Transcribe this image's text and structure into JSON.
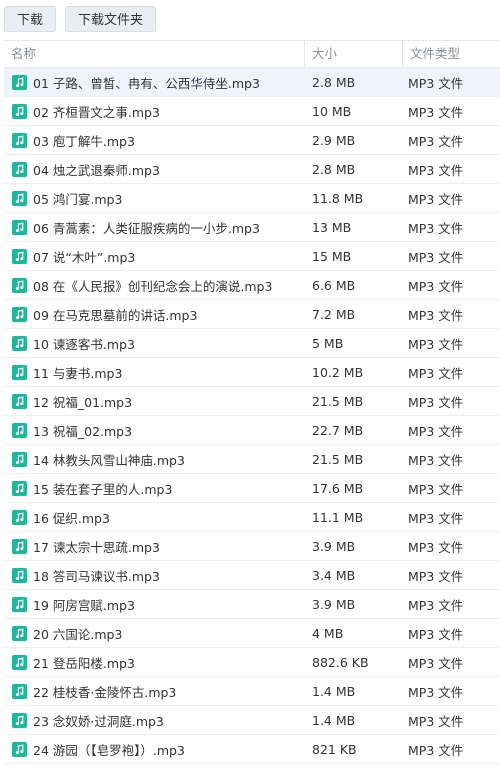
{
  "toolbar": {
    "download_label": "下载",
    "download_folder_label": "下载文件夹"
  },
  "table": {
    "headers": {
      "name": "名称",
      "size": "大小",
      "type": "文件类型"
    },
    "selected_index": 0,
    "rows": [
      {
        "name": "01 子路、曾皙、冉有、公西华侍坐.mp3",
        "size": "2.8 MB",
        "type": "MP3 文件"
      },
      {
        "name": "02 齐桓晋文之事.mp3",
        "size": "10 MB",
        "type": "MP3 文件"
      },
      {
        "name": "03 庖丁解牛.mp3",
        "size": "2.9 MB",
        "type": "MP3 文件"
      },
      {
        "name": "04 烛之武退秦师.mp3",
        "size": "2.8 MB",
        "type": "MP3 文件"
      },
      {
        "name": "05 鸿门宴.mp3",
        "size": "11.8 MB",
        "type": "MP3 文件"
      },
      {
        "name": "06 青蒿素：人类征服疾病的一小步.mp3",
        "size": "13 MB",
        "type": "MP3 文件"
      },
      {
        "name": "07 说“木叶”.mp3",
        "size": "15 MB",
        "type": "MP3 文件"
      },
      {
        "name": "08 在《人民报》创刊纪念会上的演说.mp3",
        "size": "6.6 MB",
        "type": "MP3 文件"
      },
      {
        "name": "09 在马克思墓前的讲话.mp3",
        "size": "7.2 MB",
        "type": "MP3 文件"
      },
      {
        "name": "10 谏逐客书.mp3",
        "size": "5 MB",
        "type": "MP3 文件"
      },
      {
        "name": "11 与妻书.mp3",
        "size": "10.2 MB",
        "type": "MP3 文件"
      },
      {
        "name": "12 祝福_01.mp3",
        "size": "21.5 MB",
        "type": "MP3 文件"
      },
      {
        "name": "13 祝福_02.mp3",
        "size": "22.7 MB",
        "type": "MP3 文件"
      },
      {
        "name": "14 林教头风雪山神庙.mp3",
        "size": "21.5 MB",
        "type": "MP3 文件"
      },
      {
        "name": "15 装在套子里的人.mp3",
        "size": "17.6 MB",
        "type": "MP3 文件"
      },
      {
        "name": "16 促织.mp3",
        "size": "11.1 MB",
        "type": "MP3 文件"
      },
      {
        "name": "17 谏太宗十思疏.mp3",
        "size": "3.9 MB",
        "type": "MP3 文件"
      },
      {
        "name": "18 答司马谏议书.mp3",
        "size": "3.4 MB",
        "type": "MP3 文件"
      },
      {
        "name": "19 阿房宫赋.mp3",
        "size": "3.9 MB",
        "type": "MP3 文件"
      },
      {
        "name": "20 六国论.mp3",
        "size": "4 MB",
        "type": "MP3 文件"
      },
      {
        "name": "21 登岳阳楼.mp3",
        "size": "882.6 KB",
        "type": "MP3 文件"
      },
      {
        "name": "22 桂枝香·金陵怀古.mp3",
        "size": "1.4 MB",
        "type": "MP3 文件"
      },
      {
        "name": "23 念奴娇·过洞庭.mp3",
        "size": "1.4 MB",
        "type": "MP3 文件"
      },
      {
        "name": "24 游园（【皂罗袍】）.mp3",
        "size": "821 KB",
        "type": "MP3 文件"
      }
    ]
  },
  "icon": {
    "name": "music-note-icon",
    "color": "#1bb99a"
  },
  "colors": {
    "selected_row": "#eef4fd",
    "header_text": "#8c9196",
    "button_bg": "#eaeef2"
  }
}
